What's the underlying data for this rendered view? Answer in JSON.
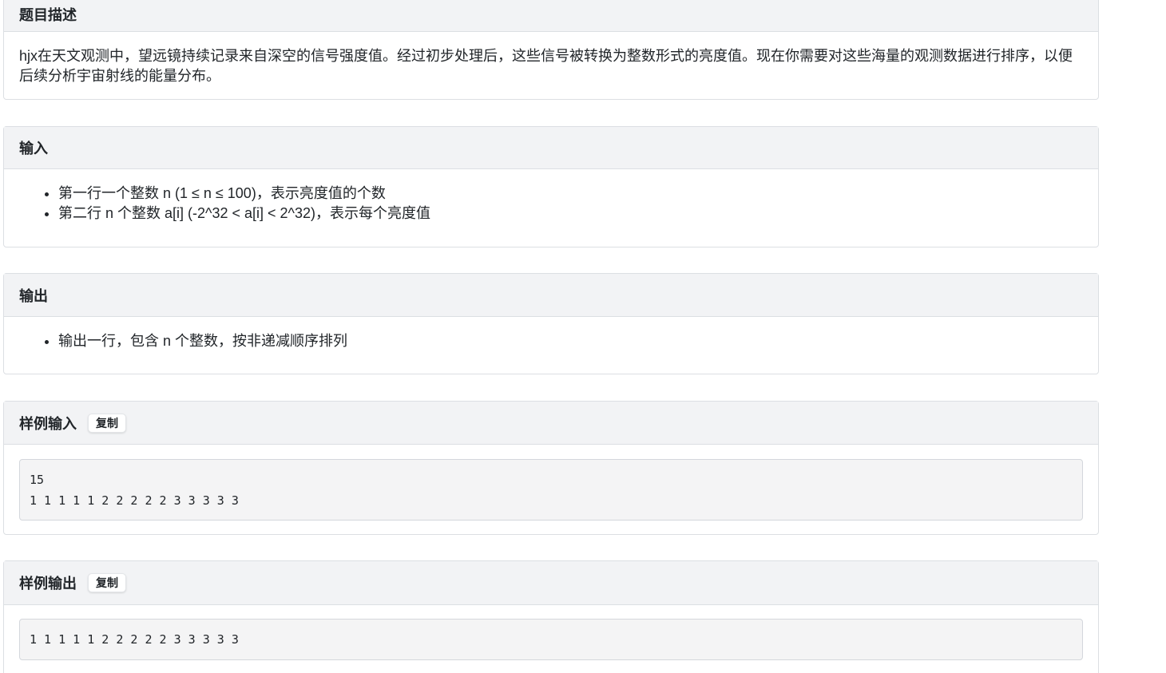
{
  "description": {
    "title": "题目描述",
    "text": "hjx在天文观测中，望远镜持续记录来自深空的信号强度值。经过初步处理后，这些信号被转换为整数形式的亮度值。现在你需要对这些海量的观测数据进行排序，以便后续分析宇宙射线的能量分布。"
  },
  "input": {
    "title": "输入",
    "items": [
      "第一行一个整数 n (1 ≤ n ≤ 100)，表示亮度值的个数",
      "第二行 n 个整数 a[i] (-2^32 < a[i] < 2^32)，表示每个亮度值"
    ]
  },
  "output": {
    "title": "输出",
    "items": [
      "输出一行，包含 n 个整数，按非递减顺序排列"
    ]
  },
  "sample_input": {
    "title": "样例输入",
    "copy_label": "复制",
    "content": "15\n1 1 1 1 1 2 2 2 2 2 3 3 3 3 3"
  },
  "sample_output": {
    "title": "样例输出",
    "copy_label": "复制",
    "content": "1 1 1 1 1 2 2 2 2 2 3 3 3 3 3"
  }
}
